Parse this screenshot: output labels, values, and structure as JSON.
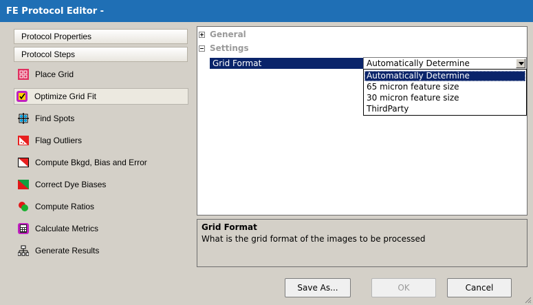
{
  "window": {
    "title": "FE Protocol Editor -"
  },
  "sidebar": {
    "protocol_properties": "Protocol Properties",
    "protocol_steps": "Protocol Steps",
    "steps": [
      {
        "label": "Place Grid",
        "icon": "place-grid-icon"
      },
      {
        "label": "Optimize Grid Fit",
        "icon": "optimize-grid-fit-icon",
        "selected": true
      },
      {
        "label": "Find Spots",
        "icon": "find-spots-icon"
      },
      {
        "label": "Flag Outliers",
        "icon": "flag-outliers-icon"
      },
      {
        "label": "Compute Bkgd, Bias and Error",
        "icon": "compute-bkgd-icon"
      },
      {
        "label": "Correct Dye Biases",
        "icon": "correct-dye-biases-icon"
      },
      {
        "label": "Compute Ratios",
        "icon": "compute-ratios-icon"
      },
      {
        "label": "Calculate Metrics",
        "icon": "calculate-metrics-icon"
      },
      {
        "label": "Generate Results",
        "icon": "generate-results-icon"
      }
    ]
  },
  "properties": {
    "general_label": "General",
    "settings_label": "Settings",
    "grid_format_label": "Grid Format",
    "grid_format_value": "Automatically Determine",
    "options": [
      "Automatically Determine",
      "65 micron feature size",
      "30 micron feature size",
      "ThirdParty"
    ]
  },
  "help": {
    "title": "Grid Format",
    "description": "What is the grid format of the images to be processed"
  },
  "buttons": {
    "save_as": "Save As...",
    "ok": "OK",
    "cancel": "Cancel"
  },
  "colors": {
    "titlebar": "#1f6fb5",
    "selection": "#0a246a"
  }
}
